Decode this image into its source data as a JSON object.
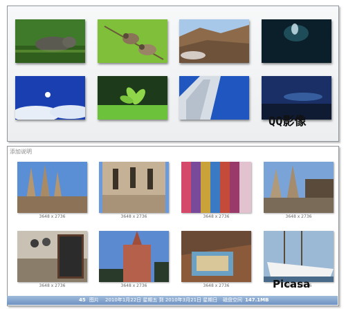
{
  "qq": {
    "label": "QQ影像",
    "thumbnails": [
      {
        "name": "hippo-in-grass"
      },
      {
        "name": "birds-on-branch"
      },
      {
        "name": "coastal-rocks"
      },
      {
        "name": "night-water"
      },
      {
        "name": "apple-sky-wallpaper"
      },
      {
        "name": "green-plant"
      },
      {
        "name": "skyscraper-up"
      },
      {
        "name": "tower-at-dusk"
      }
    ]
  },
  "picasa": {
    "label": "Picasa",
    "hint": "添加说明",
    "thumbnails": [
      {
        "name": "sagrada-familia-towers",
        "dims": "3648 x 2736"
      },
      {
        "name": "sagrada-familia-facade",
        "dims": "3648 x 2736"
      },
      {
        "name": "colorful-fabrics",
        "dims": "3648 x 2736"
      },
      {
        "name": "sagrada-familia-side",
        "dims": "3648 x 2736"
      },
      {
        "name": "cafe-menu-board",
        "dims": "3648 x 2736"
      },
      {
        "name": "church-tower",
        "dims": "3648 x 2736"
      },
      {
        "name": "tiled-building",
        "dims": "3648 x 2736"
      },
      {
        "name": "sailing-ship",
        "dims": "3648 x 2736"
      }
    ],
    "status": {
      "count": "45",
      "count_unit": "图片",
      "range": "2010年1月22日 星期五 到 2010年3月21日 星期日",
      "disk_label": "磁盘空间",
      "disk_value": "147.1MB"
    }
  },
  "colors": {
    "status_bar": "#7b9cc9",
    "panel_border": "#8d9399"
  }
}
